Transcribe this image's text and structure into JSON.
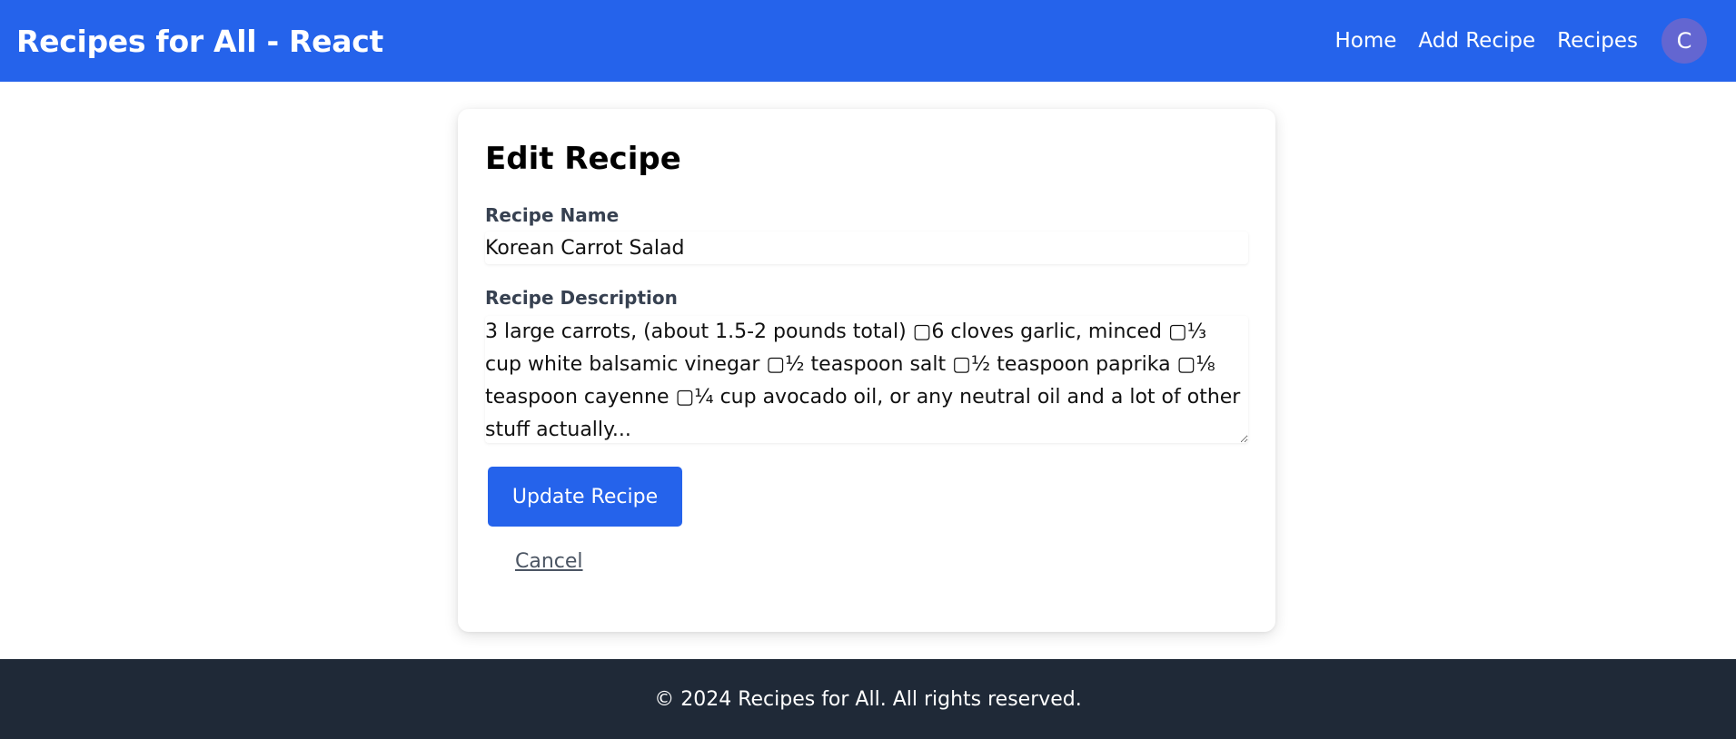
{
  "header": {
    "brand": "Recipes for All - React",
    "nav": [
      {
        "label": "Home"
      },
      {
        "label": "Add Recipe"
      },
      {
        "label": "Recipes"
      }
    ],
    "avatar_initial": "C"
  },
  "form": {
    "title": "Edit Recipe",
    "name_label": "Recipe Name",
    "name_value": "Korean Carrot Salad",
    "description_label": "Recipe Description",
    "description_value": "3 large carrots, (about 1.5-2 pounds total) ▢6 cloves garlic, minced ▢⅓ cup white balsamic vinegar ▢½ teaspoon salt ▢½ teaspoon paprika ▢⅛ teaspoon cayenne ▢¼ cup avocado oil, or any neutral oil and a lot of other stuff actually...",
    "submit_label": "Update Recipe",
    "cancel_label": "Cancel"
  },
  "footer": {
    "text": "© 2024 Recipes for All. All rights reserved."
  },
  "colors": {
    "header_bg": "#2563eb",
    "primary_button": "#2563eb",
    "avatar_bg": "#6366d1",
    "footer_bg": "#1f2937"
  }
}
